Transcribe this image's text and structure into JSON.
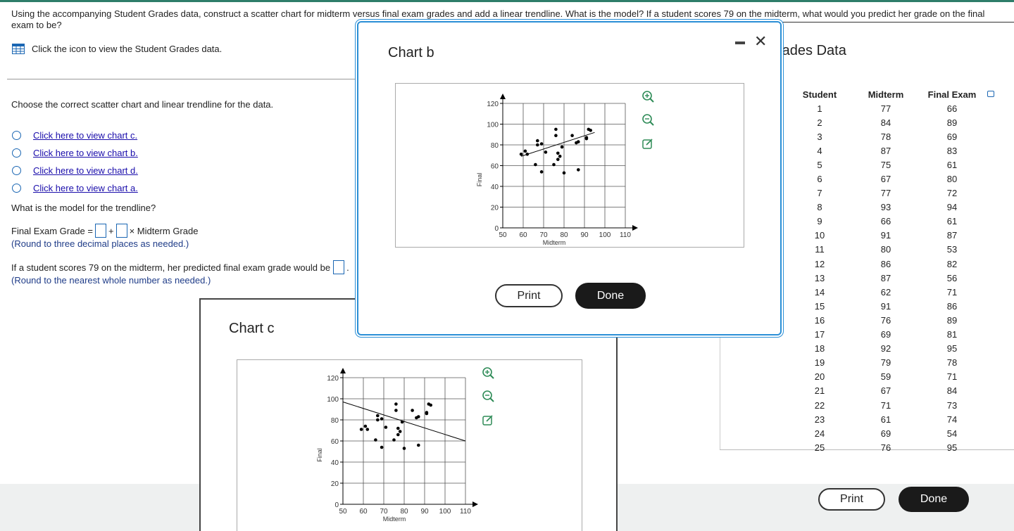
{
  "question": {
    "text": "Using the accompanying Student Grades data, construct a scatter chart for midterm versus final exam grades and add a linear trendline. What is the model? If a student scores 79 on the midterm, what would you predict her grade on the final exam to be?"
  },
  "data_link": {
    "label": "Click the icon to view the Student Grades data."
  },
  "part1": {
    "prompt": "Choose the correct scatter chart and linear trendline for the data.",
    "options": [
      "Click here to view chart c.",
      "Click here to view chart b.",
      "Click here to view chart d.",
      "Click here to view chart a."
    ]
  },
  "part2": {
    "prompt": "What is the model for the trendline?",
    "eq_prefix": "Final Exam Grade =",
    "eq_plus": "+",
    "eq_suffix": "× Midterm Grade",
    "hint": "(Round to three decimal places as needed.)"
  },
  "part3": {
    "prompt": "If a student scores 79 on the midterm, her predicted final exam grade would be",
    "period": ".",
    "hint": "(Round to the nearest whole number as needed.)"
  },
  "chart_b_window": {
    "title": "Chart b",
    "print": "Print",
    "done": "Done"
  },
  "chart_c_window": {
    "title": "Chart c"
  },
  "grades_window": {
    "title": "rades Data",
    "headers": [
      "Student",
      "Midterm",
      "Final Exam"
    ],
    "rows": [
      [
        1,
        77,
        66
      ],
      [
        2,
        84,
        89
      ],
      [
        3,
        78,
        69
      ],
      [
        4,
        87,
        83
      ],
      [
        5,
        75,
        61
      ],
      [
        6,
        67,
        80
      ],
      [
        7,
        77,
        72
      ],
      [
        8,
        93,
        94
      ],
      [
        9,
        66,
        61
      ],
      [
        10,
        91,
        87
      ],
      [
        11,
        80,
        53
      ],
      [
        12,
        86,
        82
      ],
      [
        13,
        87,
        56
      ],
      [
        14,
        62,
        71
      ],
      [
        15,
        91,
        86
      ],
      [
        16,
        76,
        89
      ],
      [
        17,
        69,
        81
      ],
      [
        18,
        92,
        95
      ],
      [
        19,
        79,
        78
      ],
      [
        20,
        59,
        71
      ],
      [
        21,
        67,
        84
      ],
      [
        22,
        71,
        73
      ],
      [
        23,
        61,
        74
      ],
      [
        24,
        69,
        54
      ],
      [
        25,
        76,
        95
      ]
    ],
    "print": "Print",
    "done": "Done"
  },
  "chart_data": [
    {
      "type": "scatter",
      "name": "Chart b",
      "xlabel": "Midterm",
      "ylabel": "Final",
      "xlim": [
        50,
        110
      ],
      "ylim": [
        0,
        120
      ],
      "xticks": [
        50,
        60,
        70,
        80,
        90,
        100,
        110
      ],
      "yticks": [
        0,
        20,
        40,
        60,
        80,
        100,
        120
      ],
      "points": [
        [
          77,
          66
        ],
        [
          84,
          89
        ],
        [
          78,
          69
        ],
        [
          87,
          83
        ],
        [
          75,
          61
        ],
        [
          67,
          80
        ],
        [
          77,
          72
        ],
        [
          93,
          94
        ],
        [
          66,
          61
        ],
        [
          91,
          87
        ],
        [
          80,
          53
        ],
        [
          86,
          82
        ],
        [
          87,
          56
        ],
        [
          62,
          71
        ],
        [
          91,
          86
        ],
        [
          76,
          89
        ],
        [
          69,
          81
        ],
        [
          92,
          95
        ],
        [
          79,
          78
        ],
        [
          59,
          71
        ],
        [
          67,
          84
        ],
        [
          71,
          73
        ],
        [
          61,
          74
        ],
        [
          69,
          54
        ],
        [
          76,
          95
        ]
      ],
      "trendline": {
        "x": [
          59,
          95
        ],
        "y": [
          69,
          92
        ]
      }
    },
    {
      "type": "scatter",
      "name": "Chart c",
      "xlabel": "Midterm",
      "ylabel": "Final",
      "xlim": [
        50,
        110
      ],
      "ylim": [
        0,
        120
      ],
      "xticks": [
        50,
        60,
        70,
        80,
        90,
        100,
        110
      ],
      "yticks": [
        0,
        20,
        40,
        60,
        80,
        100,
        120
      ],
      "points": [
        [
          77,
          66
        ],
        [
          84,
          89
        ],
        [
          78,
          69
        ],
        [
          87,
          83
        ],
        [
          75,
          61
        ],
        [
          67,
          80
        ],
        [
          77,
          72
        ],
        [
          93,
          94
        ],
        [
          66,
          61
        ],
        [
          91,
          87
        ],
        [
          80,
          53
        ],
        [
          86,
          82
        ],
        [
          87,
          56
        ],
        [
          62,
          71
        ],
        [
          91,
          86
        ],
        [
          76,
          89
        ],
        [
          69,
          81
        ],
        [
          92,
          95
        ],
        [
          79,
          78
        ],
        [
          59,
          71
        ],
        [
          67,
          84
        ],
        [
          71,
          73
        ],
        [
          61,
          74
        ],
        [
          69,
          54
        ],
        [
          76,
          95
        ]
      ],
      "trendline": {
        "x": [
          50,
          110
        ],
        "y": [
          97,
          60
        ]
      }
    }
  ],
  "colors": {
    "link": "#1a0dab",
    "window_border": "#2b8fd6",
    "dark_button": "#1a1a1a"
  },
  "icons": [
    "table-icon",
    "zoom-in-icon",
    "zoom-out-icon",
    "open-external-icon",
    "minimize-icon",
    "close-icon"
  ]
}
